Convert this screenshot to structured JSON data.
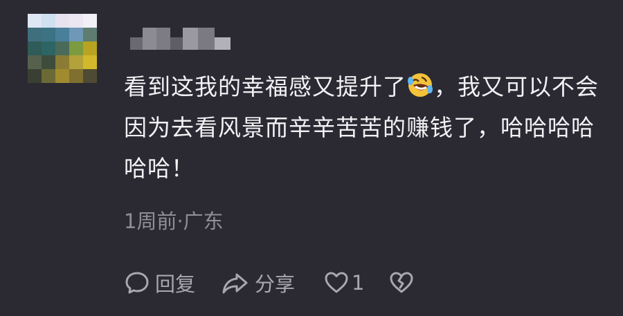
{
  "comment": {
    "text_before_emoji": "看到这我的幸福感又提升了",
    "emoji": "rolling-on-floor-laughing-emoji",
    "text_after_emoji": "，我又可以不会因为去看风景而辛辛苦苦的赚钱了，哈哈哈哈哈哈！"
  },
  "meta": "1周前·广东",
  "actions": {
    "reply_label": "回复",
    "share_label": "分享",
    "like_count": "1"
  },
  "colors": {
    "background": "#2b2a33",
    "text": "#f2f2f4",
    "muted": "#8f8e97",
    "icon": "#a9a8b1"
  }
}
